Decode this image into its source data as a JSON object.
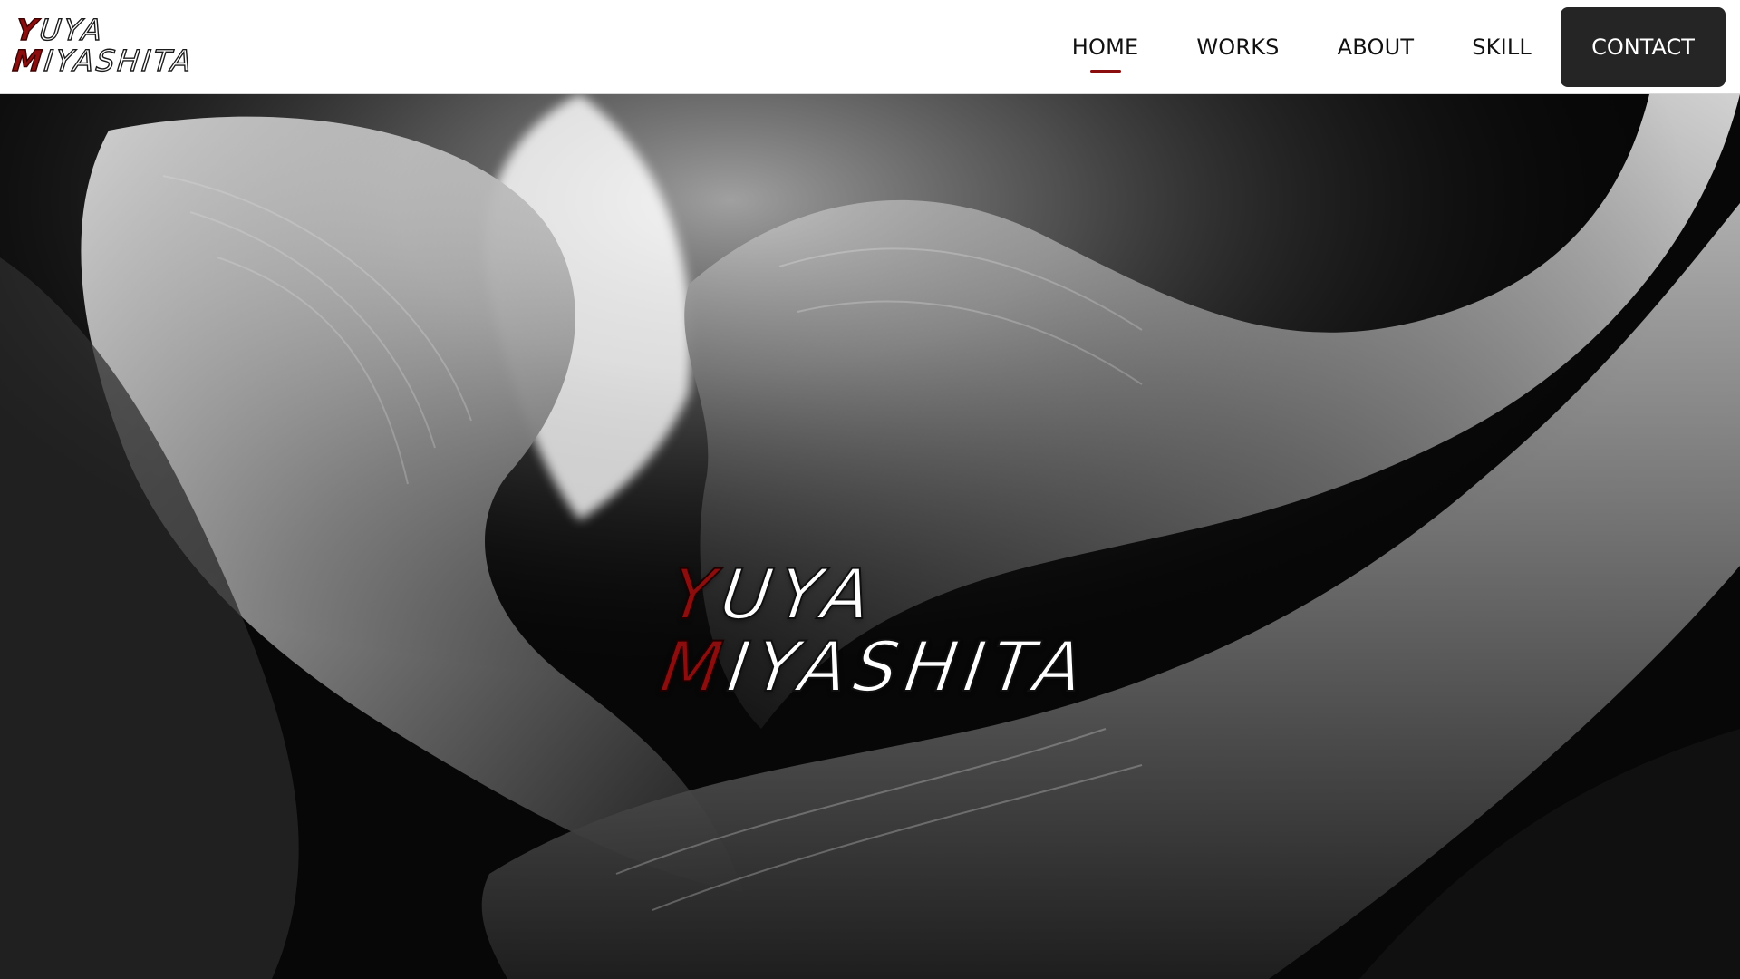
{
  "brand": {
    "logo_line1_cap": "Y",
    "logo_line1_rest": "UYA",
    "logo_line2_cap": "M",
    "logo_line2_rest": "IYASHITA",
    "accent_color": "#8c0d0d"
  },
  "nav": {
    "items": [
      {
        "label": "HOME",
        "active": true
      },
      {
        "label": "WORKS",
        "active": false
      },
      {
        "label": "ABOUT",
        "active": false
      },
      {
        "label": "SKILL",
        "active": false
      }
    ],
    "contact_label": "CONTACT"
  },
  "hero": {
    "title_line1_cap": "Y",
    "title_line1_rest": "UYA",
    "title_line2_cap": "M",
    "title_line2_rest": "IYASHITA",
    "background": "black-and-white canyon rock photograph"
  }
}
